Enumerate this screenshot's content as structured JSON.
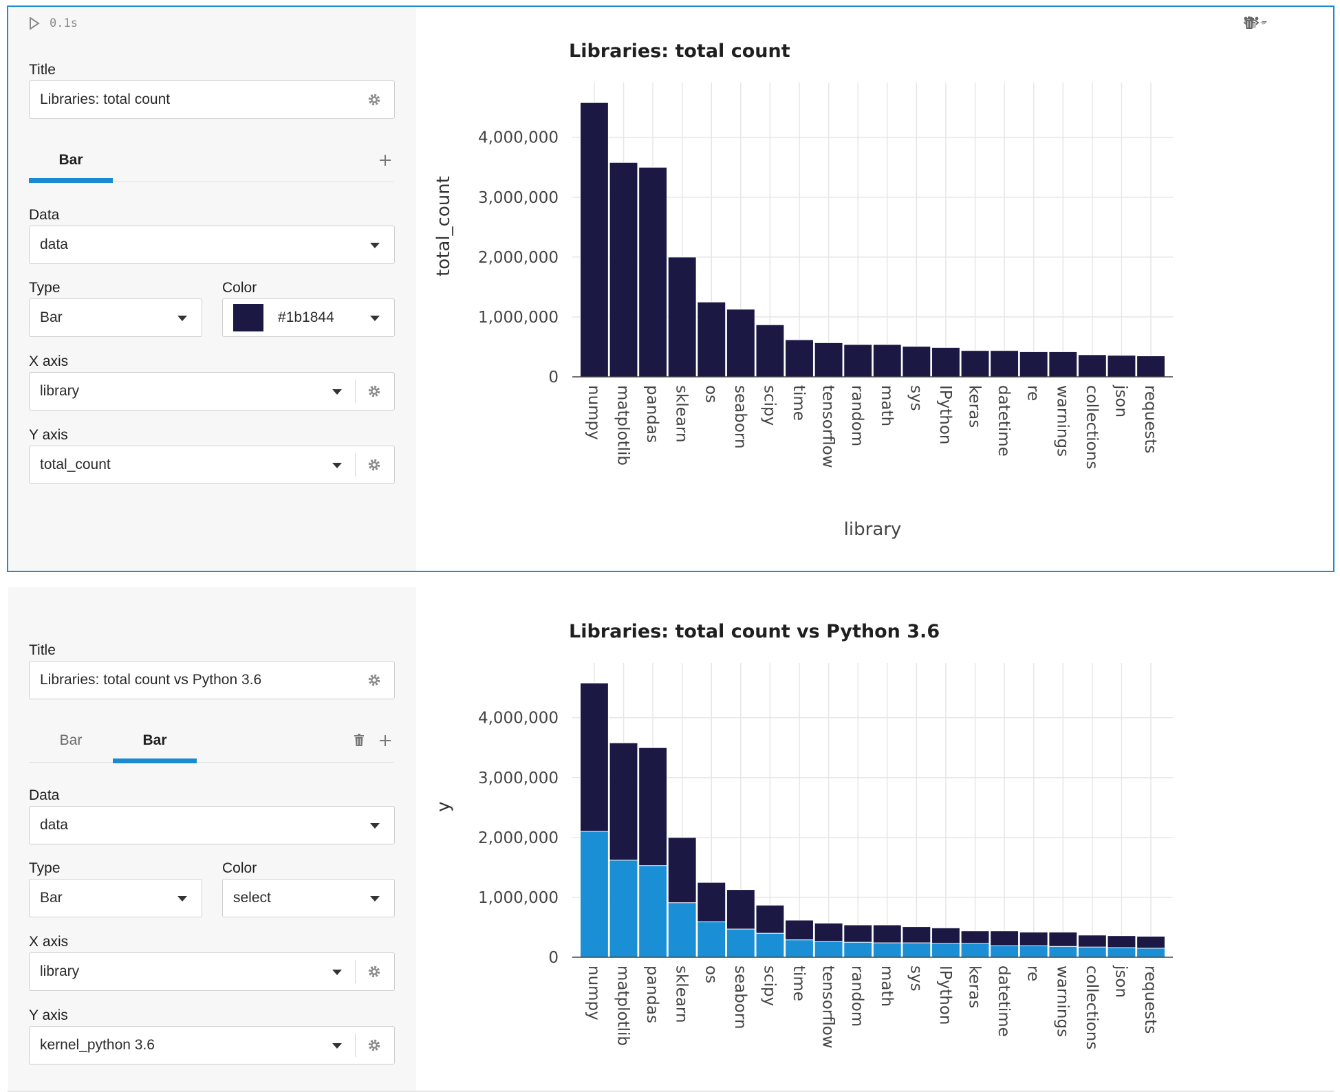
{
  "cells": [
    {
      "run_time": "0.1s",
      "toolbar": {
        "icons": [
          "eye-icon",
          "plus-icon",
          "python-icon",
          "trash-icon",
          "more-icon"
        ]
      },
      "editor": {
        "title_label": "Title",
        "title_value": "Libraries: total count",
        "tabs": [
          "Bar"
        ],
        "active_tab": 0,
        "data_label": "Data",
        "data_value": "data",
        "type_label": "Type",
        "type_value": "Bar",
        "color_label": "Color",
        "color_value": "#1b1844",
        "xaxis_label": "X axis",
        "xaxis_value": "library",
        "yaxis_label": "Y axis",
        "yaxis_value": "total_count"
      }
    },
    {
      "editor": {
        "title_label": "Title",
        "title_value": "Libraries: total count vs Python 3.6",
        "tabs": [
          "Bar",
          "Bar"
        ],
        "active_tab": 1,
        "data_label": "Data",
        "data_value": "data",
        "type_label": "Type",
        "type_value": "Bar",
        "color_label": "Color",
        "color_value": "select",
        "xaxis_label": "X axis",
        "xaxis_value": "library",
        "yaxis_label": "Y axis",
        "yaxis_value": "kernel_python 3.6"
      }
    }
  ],
  "chart_data": [
    {
      "type": "bar",
      "title": "Libraries: total count",
      "xlabel": "library",
      "ylabel": "total_count",
      "ylim": [
        0,
        4800000
      ],
      "yticks": [
        0,
        1000000,
        2000000,
        3000000,
        4000000
      ],
      "ytick_labels": [
        "0",
        "1,000,000",
        "2,000,000",
        "3,000,000",
        "4,000,000"
      ],
      "grid": true,
      "categories": [
        "numpy",
        "matplotlib",
        "pandas",
        "sklearn",
        "os",
        "seaborn",
        "scipy",
        "time",
        "tensorflow",
        "random",
        "math",
        "sys",
        "IPython",
        "keras",
        "datetime",
        "re",
        "warnings",
        "collections",
        "json",
        "requests"
      ],
      "series": [
        {
          "color": "#1b1844",
          "values": [
            4580000,
            3580000,
            3500000,
            2000000,
            1250000,
            1130000,
            870000,
            620000,
            570000,
            540000,
            540000,
            510000,
            490000,
            440000,
            440000,
            420000,
            420000,
            370000,
            360000,
            350000
          ]
        }
      ]
    },
    {
      "type": "bar",
      "title": "Libraries: total count vs Python 3.6",
      "xlabel": "",
      "ylabel": "y",
      "ylim": [
        0,
        4800000
      ],
      "yticks": [
        0,
        1000000,
        2000000,
        3000000,
        4000000
      ],
      "ytick_labels": [
        "0",
        "1,000,000",
        "2,000,000",
        "3,000,000",
        "4,000,000"
      ],
      "grid": true,
      "categories": [
        "numpy",
        "matplotlib",
        "pandas",
        "sklearn",
        "os",
        "seaborn",
        "scipy",
        "time",
        "tensorflow",
        "random",
        "math",
        "sys",
        "IPython",
        "keras",
        "datetime",
        "re",
        "warnings",
        "collections",
        "json",
        "requests"
      ],
      "series": [
        {
          "color": "#1b1844",
          "values": [
            4580000,
            3580000,
            3500000,
            2000000,
            1250000,
            1130000,
            870000,
            620000,
            570000,
            540000,
            540000,
            510000,
            490000,
            440000,
            440000,
            420000,
            420000,
            370000,
            360000,
            350000
          ]
        },
        {
          "color": "#1a8fd6",
          "values": [
            2100000,
            1620000,
            1530000,
            910000,
            590000,
            470000,
            400000,
            290000,
            260000,
            250000,
            240000,
            240000,
            230000,
            230000,
            190000,
            190000,
            180000,
            170000,
            160000,
            150000
          ]
        }
      ]
    }
  ]
}
